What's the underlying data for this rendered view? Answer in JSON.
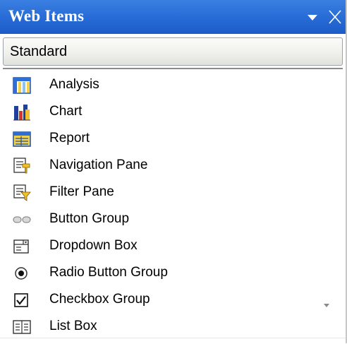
{
  "panel": {
    "title": "Web Items",
    "category": "Standard"
  },
  "items": [
    {
      "label": "Analysis",
      "icon": "analysis-icon"
    },
    {
      "label": "Chart",
      "icon": "chart-icon"
    },
    {
      "label": "Report",
      "icon": "report-icon"
    },
    {
      "label": "Navigation Pane",
      "icon": "navigation-pane-icon"
    },
    {
      "label": "Filter Pane",
      "icon": "filter-pane-icon"
    },
    {
      "label": "Button Group",
      "icon": "button-group-icon"
    },
    {
      "label": "Dropdown Box",
      "icon": "dropdown-box-icon"
    },
    {
      "label": "Radio Button Group",
      "icon": "radio-button-icon"
    },
    {
      "label": "Checkbox Group",
      "icon": "checkbox-icon"
    },
    {
      "label": "List Box",
      "icon": "list-box-icon"
    }
  ],
  "colors": {
    "title_bar": "#2a6ed8",
    "title_text": "#ffffff"
  }
}
